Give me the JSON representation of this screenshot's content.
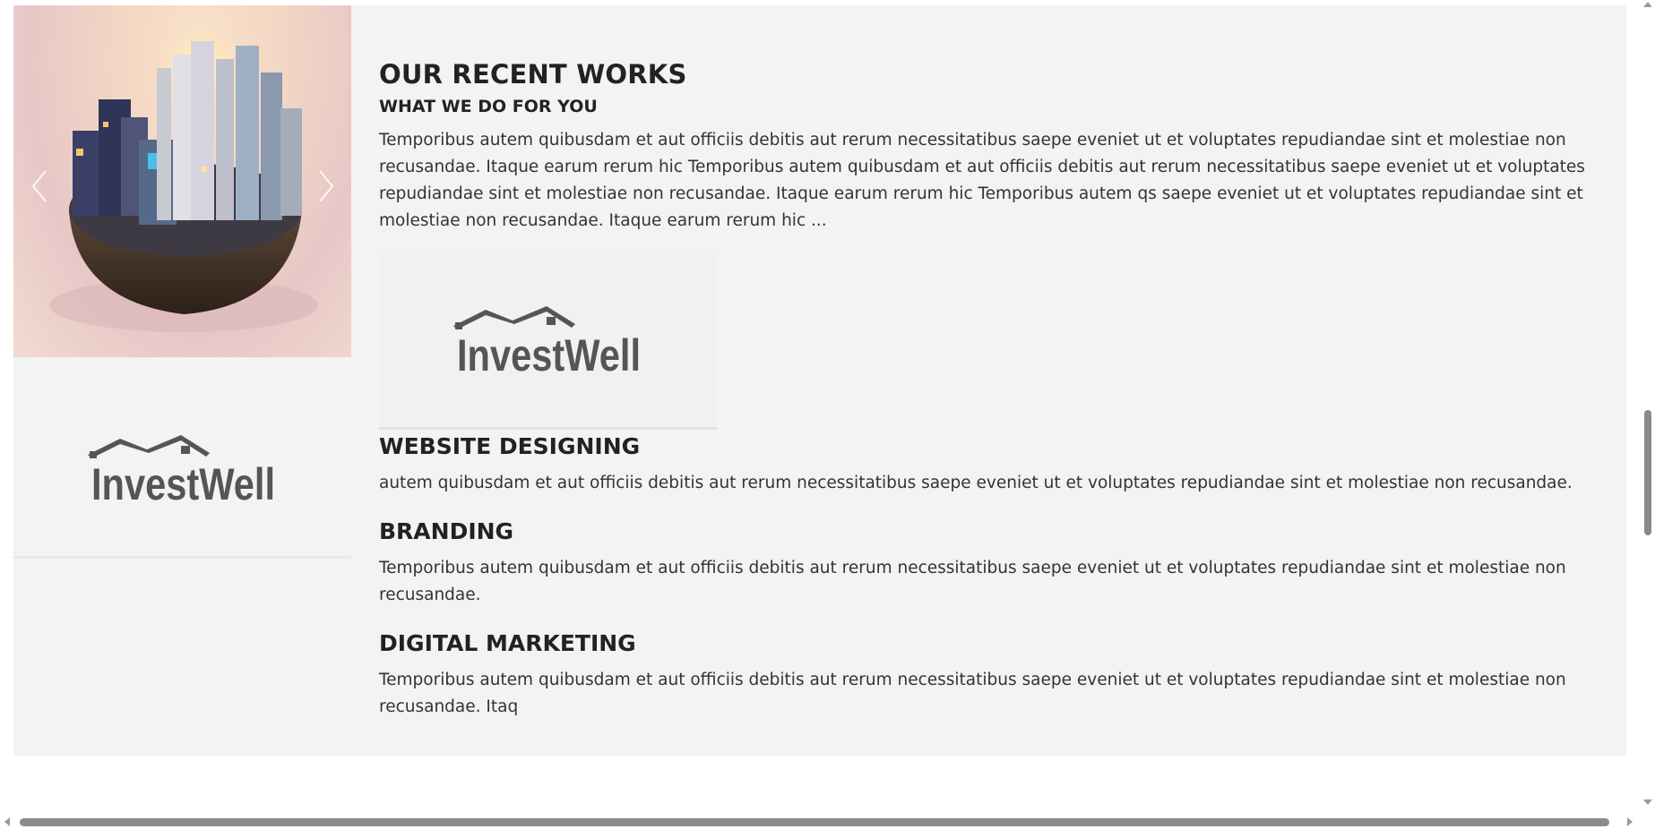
{
  "works": {
    "title": "OUR RECENT WORKS",
    "subtitle": "WHAT WE DO FOR YOU",
    "description": "Temporibus autem quibusdam et aut officiis debitis aut rerum necessitatibus saepe eveniet ut et voluptates repudiandae sint et molestiae non recusandae. Itaque earum rerum hic Temporibus autem quibusdam et aut officiis debitis aut rerum necessitatibus saepe eveniet ut et voluptates repudiandae sint et molestiae non recusandae. Itaque earum rerum hic Temporibus autem qs saepe eveniet ut et voluptates repudiandae sint et molestiae non recusandae. Itaque earum rerum hic ..."
  },
  "logo": {
    "text": "InvestWell"
  },
  "slider": {
    "prev_icon": "chevron-left-icon",
    "next_icon": "chevron-right-icon"
  },
  "services": [
    {
      "title": "WEBSITE DESIGNING",
      "text": "autem quibusdam et aut officiis debitis aut rerum necessitatibus saepe eveniet ut et voluptates repudiandae sint et molestiae non recusandae."
    },
    {
      "title": "BRANDING",
      "text": "Temporibus autem quibusdam et aut officiis debitis aut rerum necessitatibus saepe eveniet ut et voluptates repudiandae sint et molestiae non recusandae."
    },
    {
      "title": "DIGITAL MARKETING",
      "text": "Temporibus autem quibusdam et aut officiis debitis aut rerum necessitatibus saepe eveniet ut et voluptates repudiandae sint et molestiae non recusandae. Itaq"
    }
  ],
  "colors": {
    "section_bg": "#f3f3f3",
    "logo_gray": "#555555",
    "heading": "#222222"
  }
}
